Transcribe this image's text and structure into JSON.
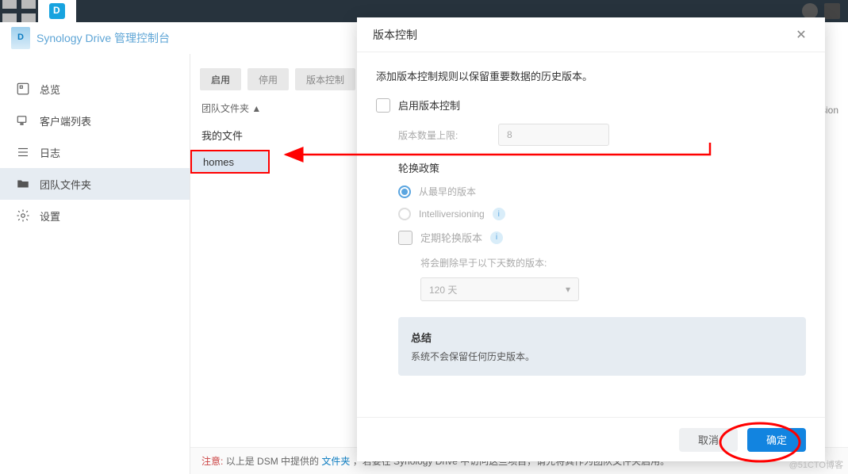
{
  "top_bar": {
    "app_name": "Synology Drive"
  },
  "header": {
    "title": "Synology Drive 管理控制台"
  },
  "sidebar": {
    "items": [
      {
        "label": "总览"
      },
      {
        "label": "客户端列表"
      },
      {
        "label": "日志"
      },
      {
        "label": "团队文件夹"
      },
      {
        "label": "设置"
      }
    ]
  },
  "toolbar": {
    "enable": "启用",
    "disable": "停用",
    "version_control": "版本控制"
  },
  "folder_header": "团队文件夹 ▲",
  "files": {
    "my_files": "我的文件",
    "homes": "homes"
  },
  "modal": {
    "title": "版本控制",
    "desc": "添加版本控制规则以保留重要数据的历史版本。",
    "enable_vc": "启用版本控制",
    "max_versions_label": "版本数量上限:",
    "max_versions_value": "8",
    "rotation_policy": "轮换政策",
    "policy_earliest": "从最早的版本",
    "policy_intelli": "Intelliversioning",
    "periodic_rotate": "定期轮换版本",
    "delete_older": "将会删除早于以下天数的版本:",
    "days_value": "120 天",
    "summary_title": "总结",
    "summary_text": "系统不会保留任何历史版本。",
    "cancel": "取消",
    "ok": "确定"
  },
  "footer": {
    "warn": "注意:",
    "text1": "以上是 DSM 中提供的 ",
    "link": "文件夹",
    "text2": "，若要在 Synology Drive 中访问这些项目，请先将其作为团队文件夹启用。"
  },
  "partial_text": "sion",
  "watermark": "@51CTO博客"
}
